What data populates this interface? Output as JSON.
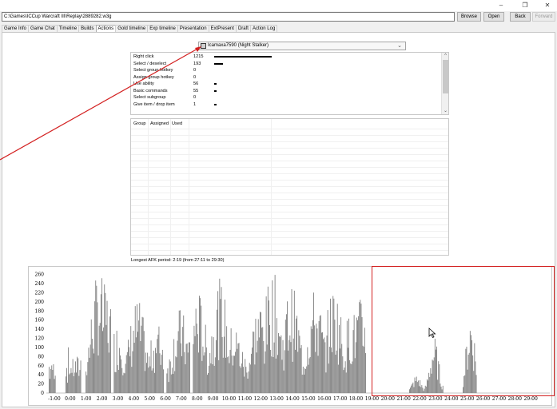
{
  "window": {
    "minimize": "–",
    "restore": "❐",
    "close": "✕"
  },
  "path": {
    "value": "C:\\Games\\ICCup Warcraft III\\Replay\\2889282.w3g"
  },
  "toolbar": {
    "browse": "Browse",
    "open": "Open",
    "back": "Back",
    "forward": "Forward"
  },
  "tabs": [
    "Game Info",
    "Game Chat",
    "Timeline",
    "Builds",
    "Actions",
    "Gold timeline",
    "Exp timeline",
    "Presentation",
    "ExtPresent",
    "Draft",
    "Action Log"
  ],
  "active_tab": "Actions",
  "player": {
    "selected": "Icamaxa7590 (Night Stalker)"
  },
  "stats": [
    {
      "label": "Right click",
      "value": "1215",
      "bar": 1215
    },
    {
      "label": "Select / deselect",
      "value": "193",
      "bar": 193
    },
    {
      "label": "Select group hotkey",
      "value": "0",
      "bar": 0
    },
    {
      "label": "Assign group hotkey",
      "value": "0",
      "bar": 0
    },
    {
      "label": "Use ability",
      "value": "56",
      "bar": 56
    },
    {
      "label": "Basic commands",
      "value": "55",
      "bar": 55
    },
    {
      "label": "Select subgroup",
      "value": "0",
      "bar": 0
    },
    {
      "label": "Give item / drop item",
      "value": "1",
      "bar": 1
    }
  ],
  "groups": {
    "columns": [
      "Group",
      "Assigned",
      "Used"
    ]
  },
  "afk": {
    "text": "Longest AFK period: 2:19 (from 27:11 to 29:30)"
  },
  "colors": {
    "bars": "#7f7f7f",
    "annotation": "#d32020"
  },
  "chart_data": {
    "type": "bar",
    "title": "",
    "xlabel": "",
    "ylabel": "",
    "ylim": [
      0,
      270
    ],
    "y_ticks": [
      0,
      20,
      40,
      60,
      80,
      100,
      120,
      140,
      160,
      180,
      200,
      220,
      240,
      260
    ],
    "x_ticks": [
      "-1:00",
      "0:00",
      "1:00",
      "2:00",
      "3:00",
      "4:00",
      "5:00",
      "6:00",
      "7:00",
      "8:00",
      "9:00",
      "10:00",
      "11:00",
      "12:00",
      "13:00",
      "14:00",
      "15:00",
      "16:00",
      "17:00",
      "18:00",
      "19:00",
      "20:00",
      "21:00",
      "22:00",
      "23:00",
      "24:00",
      "25:00",
      "26:00",
      "27:00",
      "28:00",
      "29:00"
    ],
    "x_range_minutes": [
      -1.5,
      30.2
    ],
    "series": [
      {
        "values_note_peaks": [
          {
            "t": -1.3,
            "v": 40
          },
          {
            "t": 0.4,
            "v": 80
          },
          {
            "t": 1.3,
            "v": 120
          },
          {
            "t": 1.8,
            "v": 260
          },
          {
            "t": 2.2,
            "v": 230
          },
          {
            "t": 3.0,
            "v": 150
          },
          {
            "t": 4.2,
            "v": 200
          },
          {
            "t": 5.5,
            "v": 150
          },
          {
            "t": 6.9,
            "v": 180
          },
          {
            "t": 8.0,
            "v": 220
          },
          {
            "t": 9.4,
            "v": 240
          },
          {
            "t": 10.3,
            "v": 150
          },
          {
            "t": 11.9,
            "v": 200
          },
          {
            "t": 12.7,
            "v": 260
          },
          {
            "t": 13.9,
            "v": 230
          },
          {
            "t": 15.4,
            "v": 220
          },
          {
            "t": 16.6,
            "v": 230
          },
          {
            "t": 17.7,
            "v": 180
          },
          {
            "t": 18.2,
            "v": 200
          },
          {
            "t": 18.9,
            "v": 250
          },
          {
            "t": 21.8,
            "v": 40
          },
          {
            "t": 22.9,
            "v": 120
          },
          {
            "t": 25.2,
            "v": 180
          }
        ]
      }
    ]
  }
}
